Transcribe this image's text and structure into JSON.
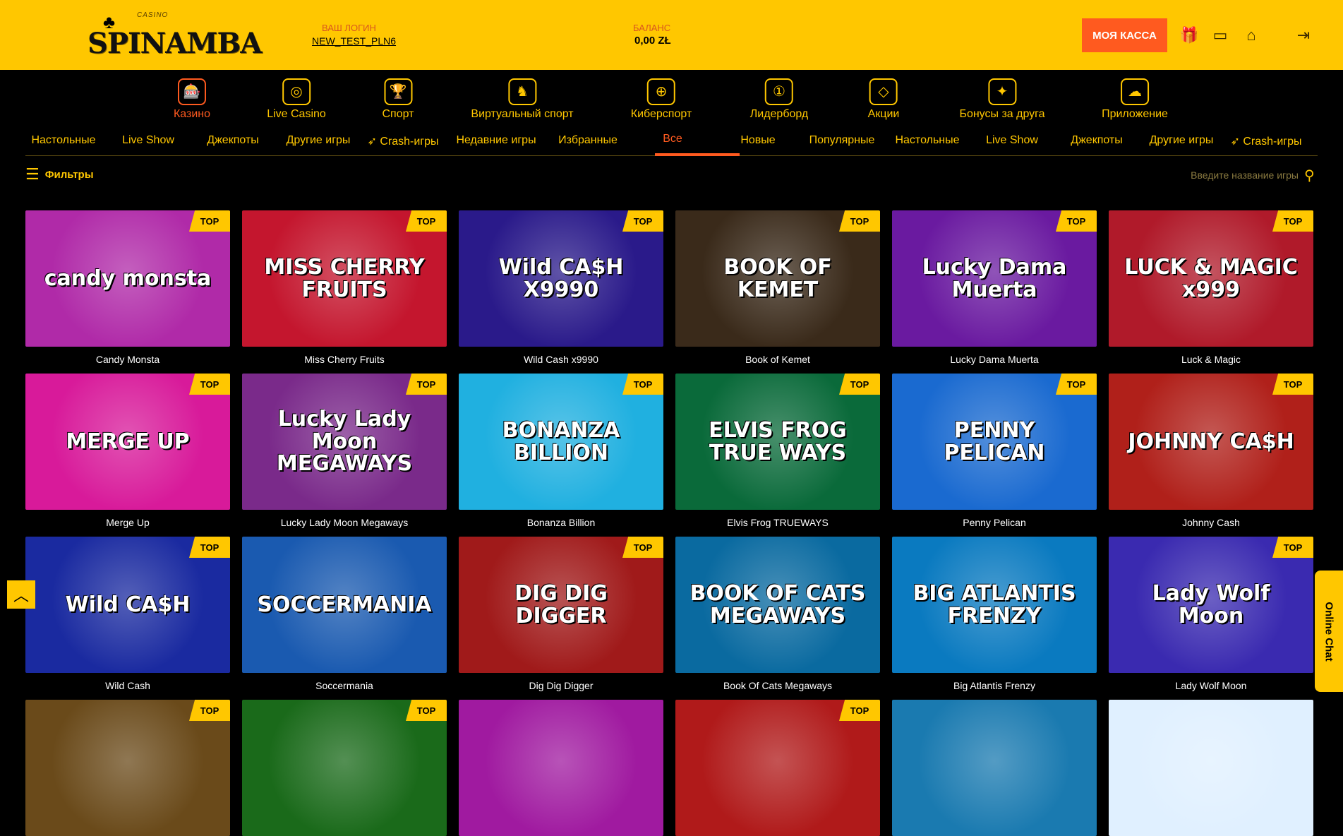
{
  "header": {
    "logo_small": "CASINO",
    "logo_word": "SPINAMBA",
    "login_label": "ВАШ ЛОГИН",
    "login_value": "NEW_TEST_PLN6",
    "balance_label": "БАЛАНС",
    "balance_value": "0,00 ZŁ",
    "cash_button": "МОЯ КАССА",
    "icons": [
      "gift-icon",
      "card-icon",
      "shop-icon",
      "logout-icon"
    ]
  },
  "main_nav": [
    {
      "label": "Казино",
      "icon": "slot-machine-icon",
      "active": true
    },
    {
      "label": "Live Casino",
      "icon": "webcam-icon"
    },
    {
      "label": "Спорт",
      "icon": "trophy-icon"
    },
    {
      "label": "Виртуальный спорт",
      "icon": "horse-icon"
    },
    {
      "label": "Киберспорт",
      "icon": "globe-icon"
    },
    {
      "label": "Лидерборд",
      "icon": "leaderboard-icon"
    },
    {
      "label": "Акции",
      "icon": "diamond-icon"
    },
    {
      "label": "Бонусы за друга",
      "icon": "friend-gift-icon"
    },
    {
      "label": "Приложение",
      "icon": "cloud-download-icon"
    }
  ],
  "sub_nav": [
    "Настольные",
    "Live Show",
    "Джекпоты",
    "Другие игры",
    "Crash-игры",
    "Недавние игры",
    "Избранные",
    "Все",
    "Новые",
    "Популярные",
    "Настольные",
    "Live Show",
    "Джекпоты",
    "Другие игры",
    "Crash-игры"
  ],
  "sub_nav_active": "Все",
  "filters_label": "Фильтры",
  "search_placeholder": "Введите название игры",
  "top_badge": "TOP",
  "games": [
    {
      "name": "Candy Monsta",
      "art": "candy monsta",
      "top": true,
      "bg": "#b02aa8"
    },
    {
      "name": "Miss Cherry Fruits",
      "art": "MISS CHERRY FRUITS",
      "top": true,
      "bg": "#c4162e"
    },
    {
      "name": "Wild Cash x9990",
      "art": "Wild CA$H X9990",
      "top": true,
      "bg": "#2a1a8a"
    },
    {
      "name": "Book of Kemet",
      "art": "BOOK OF KEMET",
      "top": true,
      "bg": "#3a2a1a"
    },
    {
      "name": "Lucky Dama Muerta",
      "art": "Lucky Dama Muerta",
      "top": true,
      "bg": "#6a1aa0"
    },
    {
      "name": "Luck & Magic",
      "art": "LUCK & MAGIC x999",
      "top": true,
      "bg": "#b01a2a"
    },
    {
      "name": "Merge Up",
      "art": "MERGE UP",
      "top": true,
      "bg": "#d81a9a"
    },
    {
      "name": "Lucky Lady Moon Megaways",
      "art": "Lucky Lady Moon MEGAWAYS",
      "top": true,
      "bg": "#7a2a8a"
    },
    {
      "name": "Bonanza Billion",
      "art": "BONANZA BILLION",
      "top": true,
      "bg": "#20b0e0"
    },
    {
      "name": "Elvis Frog TRUEWAYS",
      "art": "ELVIS FROG TRUE WAYS",
      "top": true,
      "bg": "#0a6a3a"
    },
    {
      "name": "Penny Pelican",
      "art": "PENNY PELICAN",
      "top": true,
      "bg": "#1a6ad0"
    },
    {
      "name": "Johnny Cash",
      "art": "JOHNNY CA$H",
      "top": true,
      "bg": "#b0201a"
    },
    {
      "name": "Wild Cash",
      "art": "Wild CA$H",
      "top": true,
      "bg": "#1a2aa0"
    },
    {
      "name": "Soccermania",
      "art": "SOCCERMANIA",
      "top": false,
      "bg": "#1a5ab0"
    },
    {
      "name": "Dig Dig Digger",
      "art": "DIG DIG DIGGER",
      "top": true,
      "bg": "#a01a1a"
    },
    {
      "name": "Book Of Cats Megaways",
      "art": "BOOK OF CATS MEGAWAYS",
      "top": false,
      "bg": "#0a6aa0"
    },
    {
      "name": "Big Atlantis Frenzy",
      "art": "BIG ATLANTIS FRENZY",
      "top": false,
      "bg": "#0a7ac0"
    },
    {
      "name": "Lady Wolf Moon",
      "art": "Lady Wolf Moon",
      "top": true,
      "bg": "#3a2ab0"
    },
    {
      "name": "",
      "art": "",
      "top": true,
      "bg": "#6a4a1a"
    },
    {
      "name": "",
      "art": "",
      "top": true,
      "bg": "#1a6a1a"
    },
    {
      "name": "",
      "art": "",
      "top": false,
      "bg": "#a01aa0"
    },
    {
      "name": "",
      "art": "",
      "top": true,
      "bg": "#b01a1a"
    },
    {
      "name": "",
      "art": "",
      "top": false,
      "bg": "#1a7ab0"
    },
    {
      "name": "",
      "art": "",
      "top": false,
      "bg": "#e0f0ff"
    }
  ],
  "online_chat": "Online Chat",
  "colors": {
    "brand": "#ffc700",
    "accent": "#ff5a1f",
    "bg": "#000000"
  }
}
